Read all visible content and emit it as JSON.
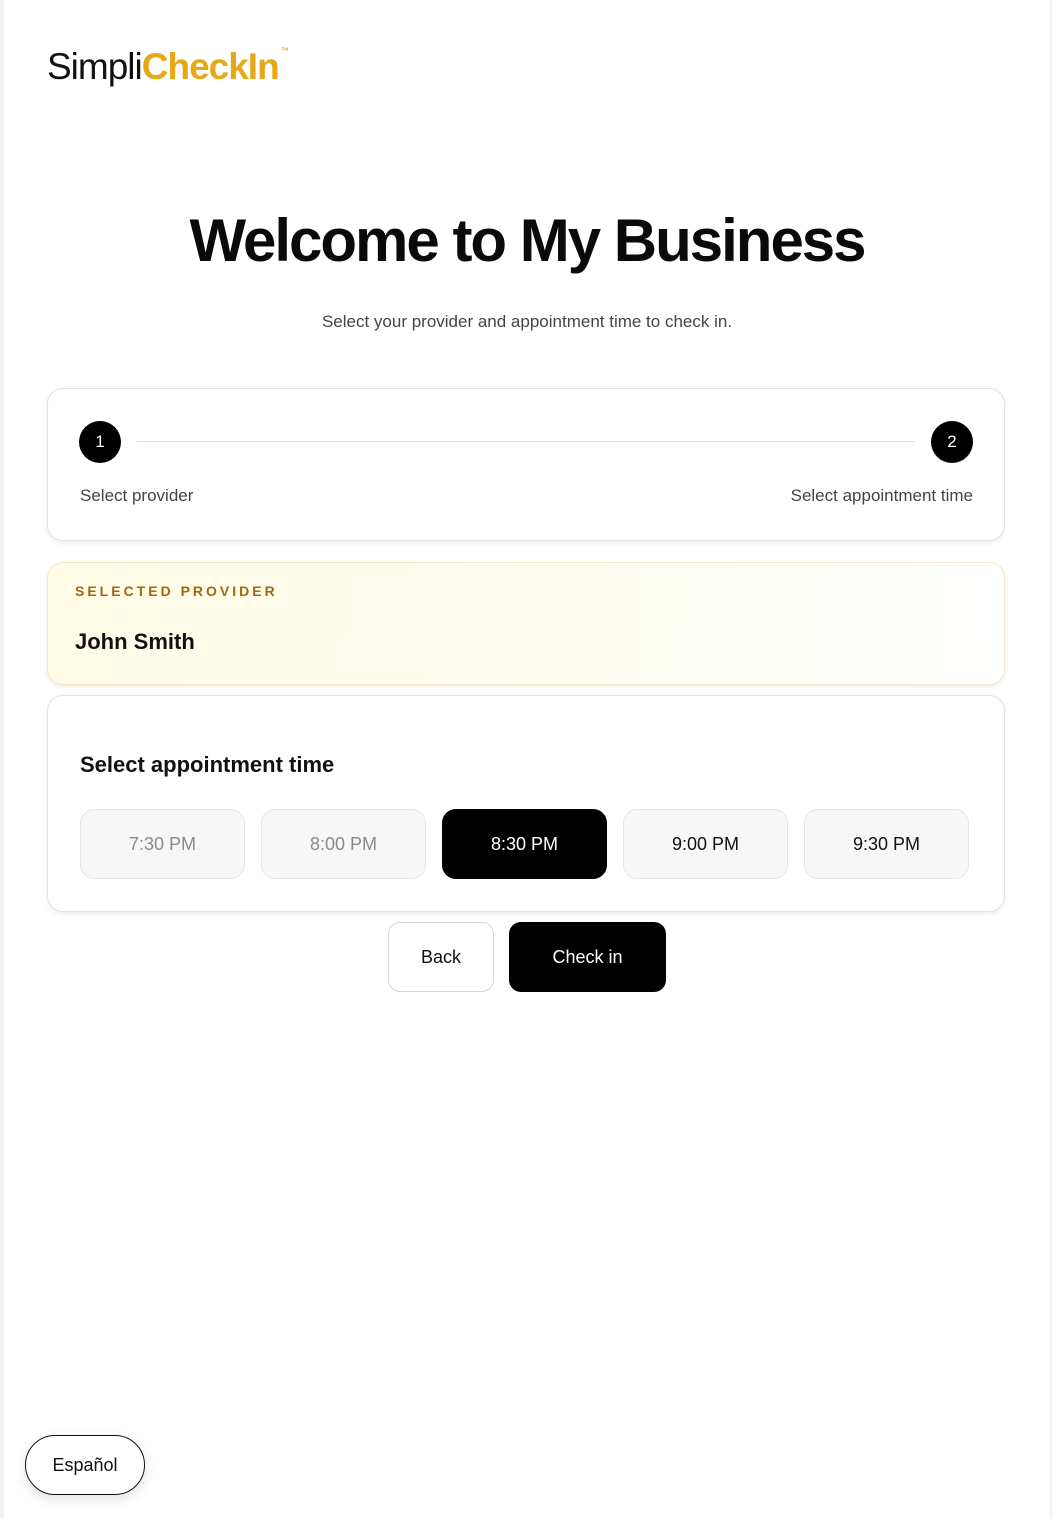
{
  "brand": {
    "name_part1": "Simpli",
    "name_part2": "CheckIn",
    "trademark": "™",
    "accent_color": "#e6a817"
  },
  "header": {
    "title": "Welcome to My Business",
    "subtitle": "Select your provider and appointment time to check in."
  },
  "stepper": {
    "steps": [
      {
        "number": "1",
        "label": "Select provider"
      },
      {
        "number": "2",
        "label": "Select appointment time"
      }
    ]
  },
  "provider": {
    "caption": "SELECTED PROVIDER",
    "name": "John Smith"
  },
  "appointment": {
    "heading": "Select appointment time",
    "slots": [
      {
        "label": "7:30 PM",
        "state": "disabled"
      },
      {
        "label": "8:00 PM",
        "state": "disabled"
      },
      {
        "label": "8:30 PM",
        "state": "selected"
      },
      {
        "label": "9:00 PM",
        "state": "available"
      },
      {
        "label": "9:30 PM",
        "state": "available"
      }
    ]
  },
  "actions": {
    "back_label": "Back",
    "checkin_label": "Check in"
  },
  "language": {
    "toggle_label": "Español"
  }
}
